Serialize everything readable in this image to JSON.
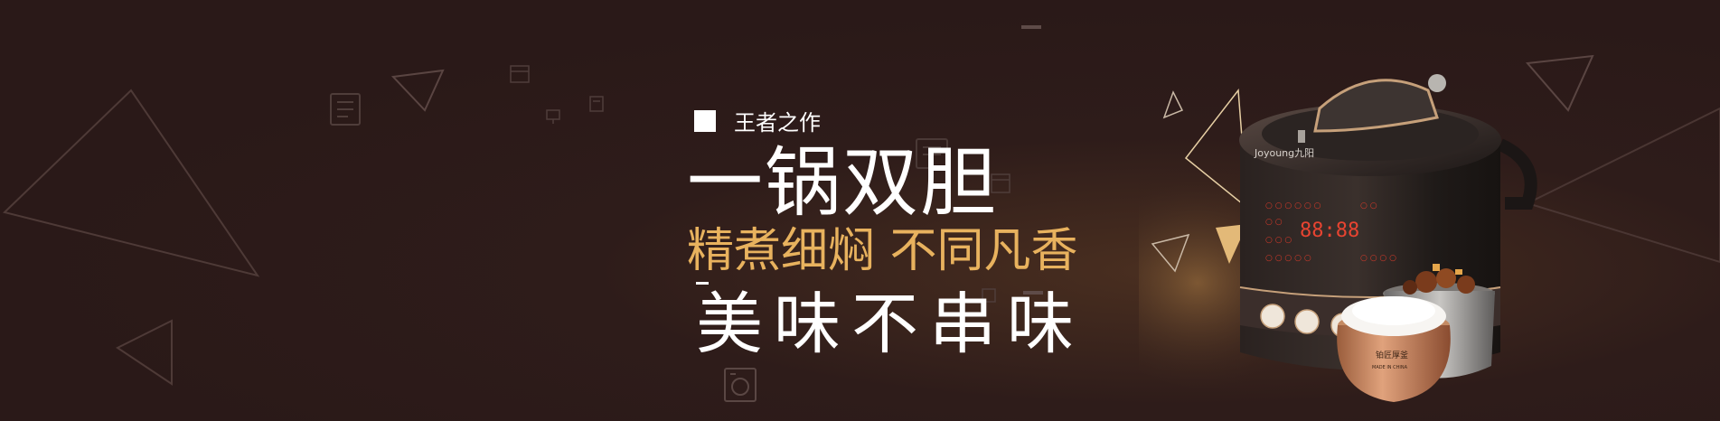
{
  "banner": {
    "tagline": "王者之作",
    "headline": "一锅双胆",
    "subline": "精煮细焖 不同凡香",
    "tagline3": "美味不串味",
    "accent_color": "#e8b25e",
    "background_color": "#2b1a19"
  },
  "product": {
    "brand": "Joyoung九阳",
    "display_digits": "88:88",
    "panel_buttons": [
      "保温取消",
      "精米",
      "预约时间",
      "开盖吸开"
    ],
    "pot_label": "铂匠厚釜",
    "pot_sublabel": "MADE IN CHINA",
    "icon": "pressure-cooker-icon"
  },
  "decorations": {
    "icons": [
      "document-icon",
      "calendar-icon",
      "monitor-icon",
      "washer-icon",
      "triangle-outline-icon"
    ]
  }
}
